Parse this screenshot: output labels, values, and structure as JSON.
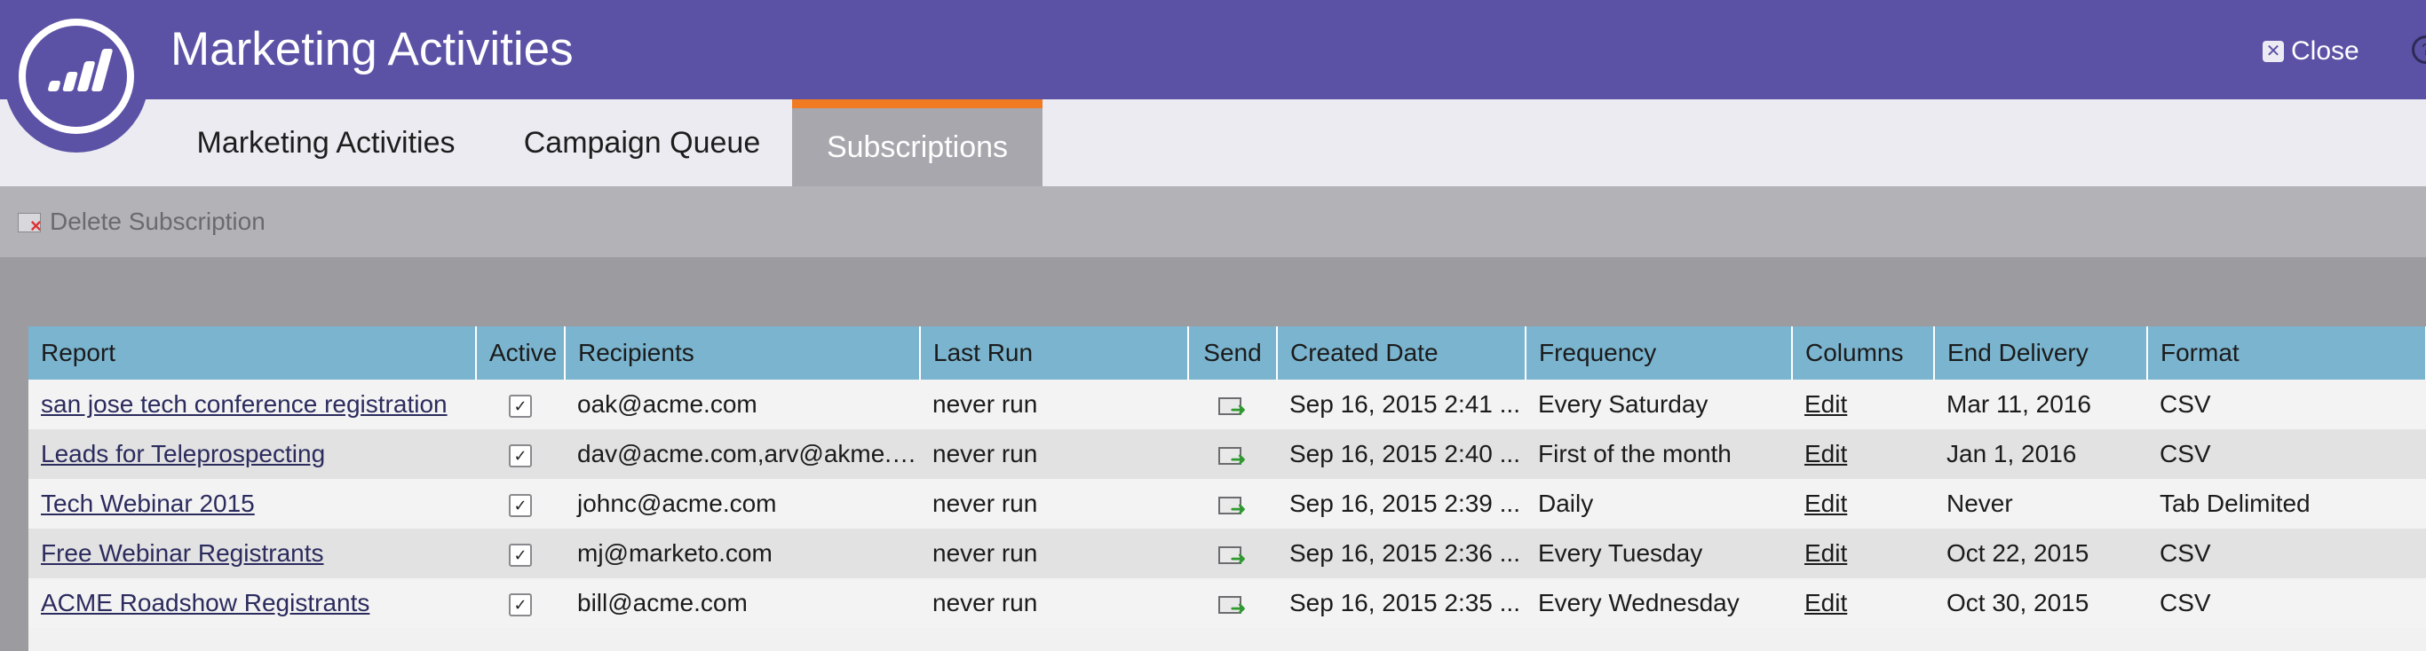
{
  "header": {
    "title": "Marketing Activities",
    "close_label": "Close",
    "help_glyph": "?"
  },
  "tabs": [
    {
      "label": "Marketing Activities",
      "active": false
    },
    {
      "label": "Campaign Queue",
      "active": false
    },
    {
      "label": "Subscriptions",
      "active": true
    }
  ],
  "toolbar": {
    "delete_label": "Delete Subscription"
  },
  "table": {
    "columns": [
      "Report",
      "Active",
      "Recipients",
      "Last Run",
      "Send",
      "Created Date",
      "Frequency",
      "Columns",
      "End Delivery",
      "Format"
    ],
    "rows": [
      {
        "report": "san jose tech conference registration",
        "active": true,
        "recipients": "oak@acme.com",
        "last_run": "never run",
        "created": "Sep 16, 2015 2:41 ...",
        "frequency": "Every Saturday",
        "columns": "Edit",
        "end_delivery": "Mar 11, 2016",
        "format": "CSV"
      },
      {
        "report": "Leads for Teleprospecting",
        "active": true,
        "recipients": "dav@acme.com,arv@akme.c...",
        "last_run": "never run",
        "created": "Sep 16, 2015 2:40 ...",
        "frequency": "First of the month",
        "columns": "Edit",
        "end_delivery": "Jan 1, 2016",
        "format": "CSV"
      },
      {
        "report": "Tech Webinar 2015",
        "active": true,
        "recipients": "johnc@acme.com",
        "last_run": "never run",
        "created": "Sep 16, 2015 2:39 ...",
        "frequency": "Daily",
        "columns": "Edit",
        "end_delivery": "Never",
        "format": "Tab Delimited"
      },
      {
        "report": "Free Webinar Registrants",
        "active": true,
        "recipients": "mj@marketo.com",
        "last_run": "never run",
        "created": "Sep 16, 2015 2:36 ...",
        "frequency": "Every Tuesday",
        "columns": "Edit",
        "end_delivery": "Oct 22, 2015",
        "format": "CSV"
      },
      {
        "report": "ACME Roadshow Registrants",
        "active": true,
        "recipients": "bill@acme.com",
        "last_run": "never run",
        "created": "Sep 16, 2015 2:35 ...",
        "frequency": "Every Wednesday",
        "columns": "Edit",
        "end_delivery": "Oct 30, 2015",
        "format": "CSV"
      }
    ]
  },
  "icons": {
    "logo": "marketo-logo-icon",
    "close": "close-icon",
    "help": "help-icon",
    "delete": "delete-subscription-icon",
    "send": "send-report-icon",
    "checkbox": "checkbox-checked-icon"
  },
  "colors": {
    "header": "#5b52a6",
    "tab_active_accent": "#f07b22",
    "grid_header": "#7ab4cf"
  }
}
